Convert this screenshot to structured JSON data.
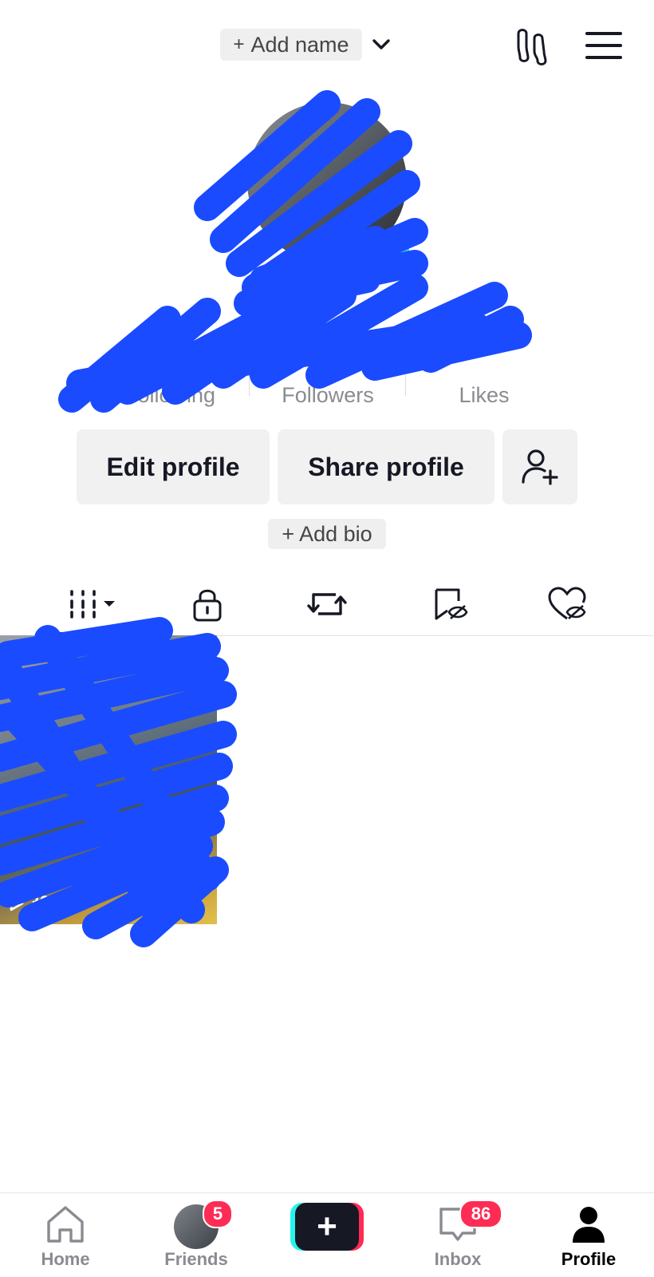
{
  "header": {
    "add_name_plus": "+",
    "add_name_label": "Add name"
  },
  "stats": [
    {
      "label": "Following"
    },
    {
      "label": "Followers"
    },
    {
      "label": "Likes"
    }
  ],
  "actions": {
    "edit_profile": "Edit profile",
    "share_profile": "Share profile"
  },
  "bio": {
    "plus": "+",
    "label": "Add bio"
  },
  "tabs": [
    {
      "icon": "videos-grid-icon"
    },
    {
      "icon": "lock-icon"
    },
    {
      "icon": "repost-icon"
    },
    {
      "icon": "favorites-hidden-icon"
    },
    {
      "icon": "liked-hidden-icon"
    }
  ],
  "video": {
    "views": "30"
  },
  "bottom_nav": {
    "home": "Home",
    "friends": "Friends",
    "friends_badge": "5",
    "inbox": "Inbox",
    "inbox_badge": "86",
    "profile": "Profile"
  },
  "colors": {
    "redaction": "#1a4bff",
    "badge": "#fe2c55",
    "create_cyan": "#25f4ee",
    "create_red": "#fe2c55",
    "text_primary": "#161823",
    "text_secondary": "#8a8b91"
  }
}
